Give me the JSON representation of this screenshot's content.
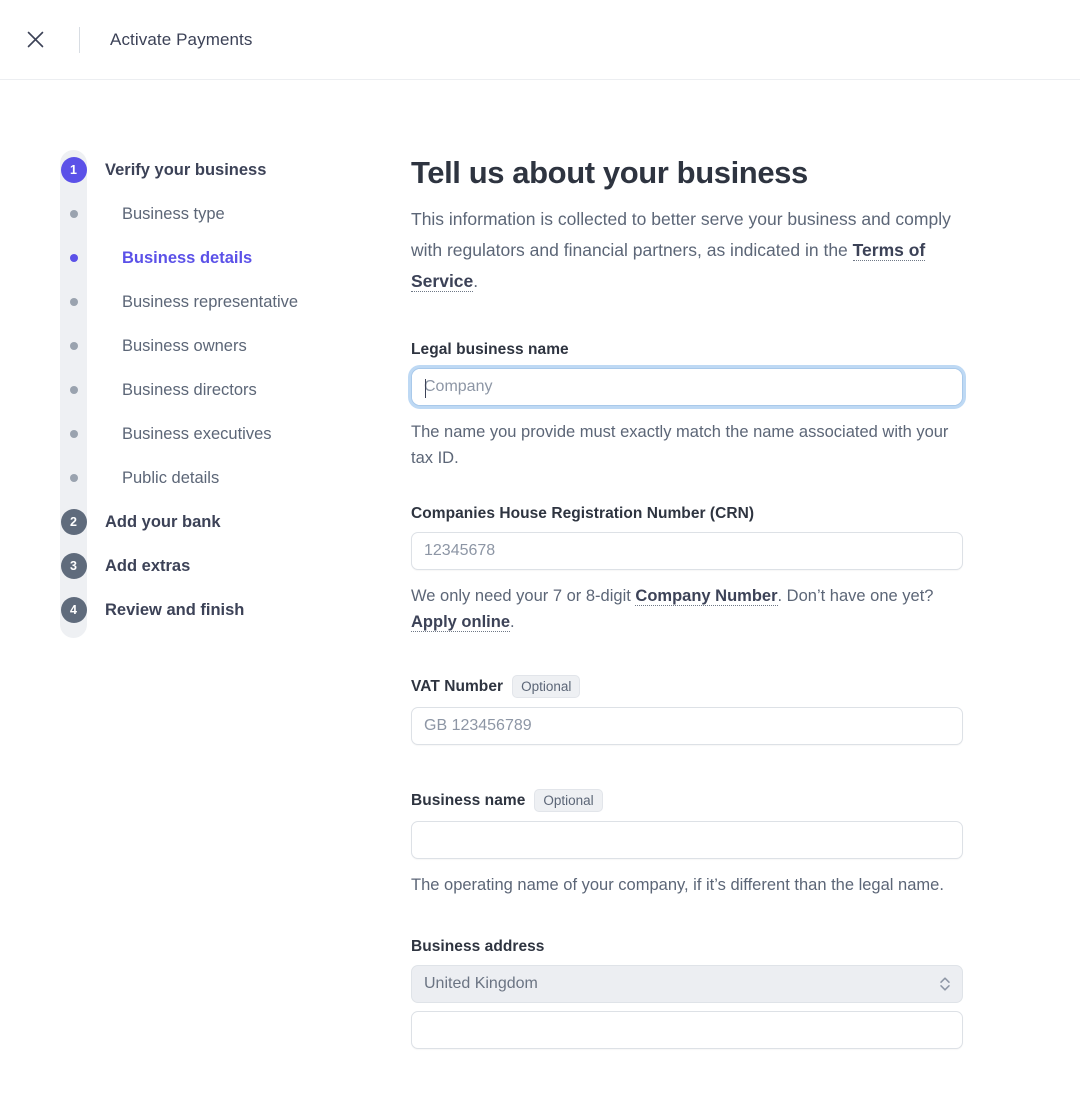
{
  "header": {
    "close_icon": "close-icon",
    "title": "Activate Payments"
  },
  "stepper": {
    "steps": [
      {
        "type": "number",
        "marker": "1",
        "label": "Verify your business",
        "state": "active"
      },
      {
        "type": "dot",
        "label": "Business type",
        "state": "todo"
      },
      {
        "type": "dot",
        "label": "Business details",
        "state": "current"
      },
      {
        "type": "dot",
        "label": "Business representative",
        "state": "todo"
      },
      {
        "type": "dot",
        "label": "Business owners",
        "state": "todo"
      },
      {
        "type": "dot",
        "label": "Business directors",
        "state": "todo"
      },
      {
        "type": "dot",
        "label": "Business executives",
        "state": "todo"
      },
      {
        "type": "dot",
        "label": "Public details",
        "state": "todo"
      },
      {
        "type": "number",
        "marker": "2",
        "label": "Add your bank",
        "state": "todo"
      },
      {
        "type": "number",
        "marker": "3",
        "label": "Add extras",
        "state": "todo"
      },
      {
        "type": "number",
        "marker": "4",
        "label": "Review and finish",
        "state": "todo"
      }
    ]
  },
  "main": {
    "title": "Tell us about your business",
    "intro_before": "This information is collected to better serve your business and comply with regulators and financial partners, as indicated in the ",
    "intro_link": "Terms of Service",
    "intro_after": ".",
    "fields": {
      "legal_business_name": {
        "label": "Legal business name",
        "value": "",
        "placeholder": "Company",
        "help": "The name you provide must exactly match the name associated with your tax ID."
      },
      "crn": {
        "label": "Companies House Registration Number (CRN)",
        "value": "",
        "placeholder": "12345678",
        "help_part1": "We only need your 7 or 8-digit ",
        "help_link1": "Company Number",
        "help_part2": ". Don’t have one yet? ",
        "help_link2": "Apply online",
        "help_part3": "."
      },
      "vat_number": {
        "label": "VAT Number",
        "badge": "Optional",
        "value": "",
        "placeholder": "GB 123456789"
      },
      "business_name": {
        "label": "Business name",
        "badge": "Optional",
        "value": "",
        "placeholder": "",
        "help": "The operating name of your company, if it’s different than the legal name."
      },
      "business_address": {
        "label": "Business address",
        "country_value": "United Kingdom",
        "line1_value": "",
        "line1_placeholder": ""
      }
    }
  },
  "colors": {
    "accent": "#5b51e8",
    "step_gray": "#5f6b7c",
    "track": "#eef0f3",
    "text_primary": "#2e3440",
    "text_muted": "#5c6677",
    "focus_ring": "#bed9f4"
  }
}
